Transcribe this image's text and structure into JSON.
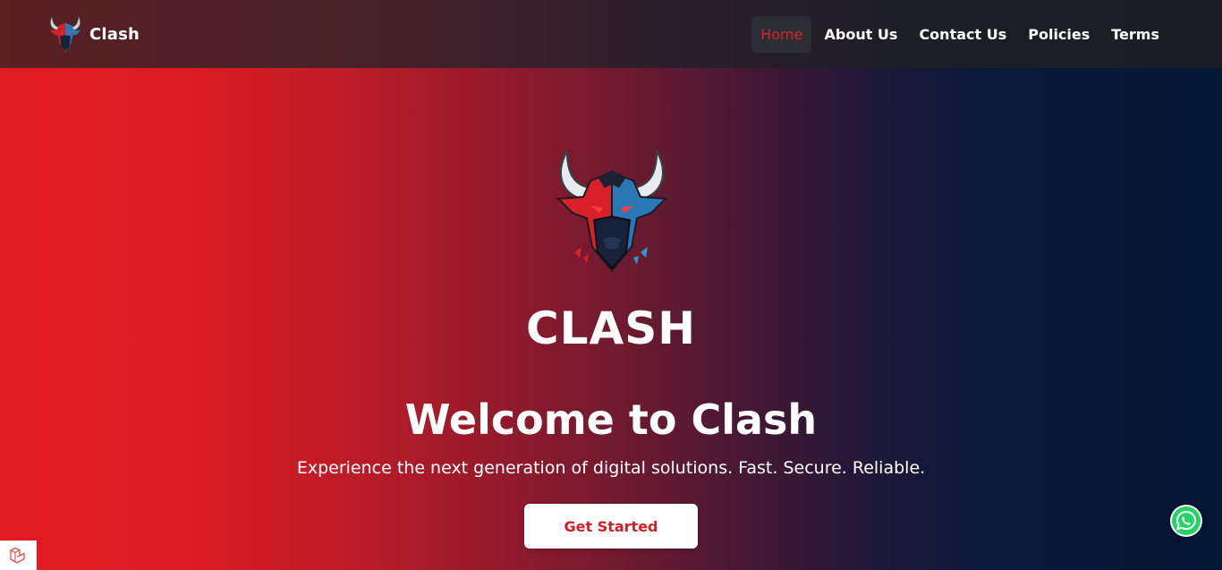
{
  "brand": {
    "name": "Clash"
  },
  "nav": {
    "items": [
      {
        "label": "Home",
        "active": true
      },
      {
        "label": "About Us",
        "active": false
      },
      {
        "label": "Contact Us",
        "active": false
      },
      {
        "label": "Policies",
        "active": false
      },
      {
        "label": "Terms",
        "active": false
      }
    ]
  },
  "hero": {
    "name": "CLASH",
    "title": "Welcome to Clash",
    "subtitle": "Experience the next generation of digital solutions. Fast. Secure. Reliable.",
    "cta_label": "Get Started"
  },
  "icons": {
    "logo": "bull-logo-icon",
    "whatsapp": "whatsapp-icon",
    "corner": "laravel-icon"
  },
  "colors": {
    "brand_red": "#e11c22",
    "brand_navy": "#041735",
    "active_nav": "#d9242b",
    "whatsapp_green": "#25d366"
  }
}
